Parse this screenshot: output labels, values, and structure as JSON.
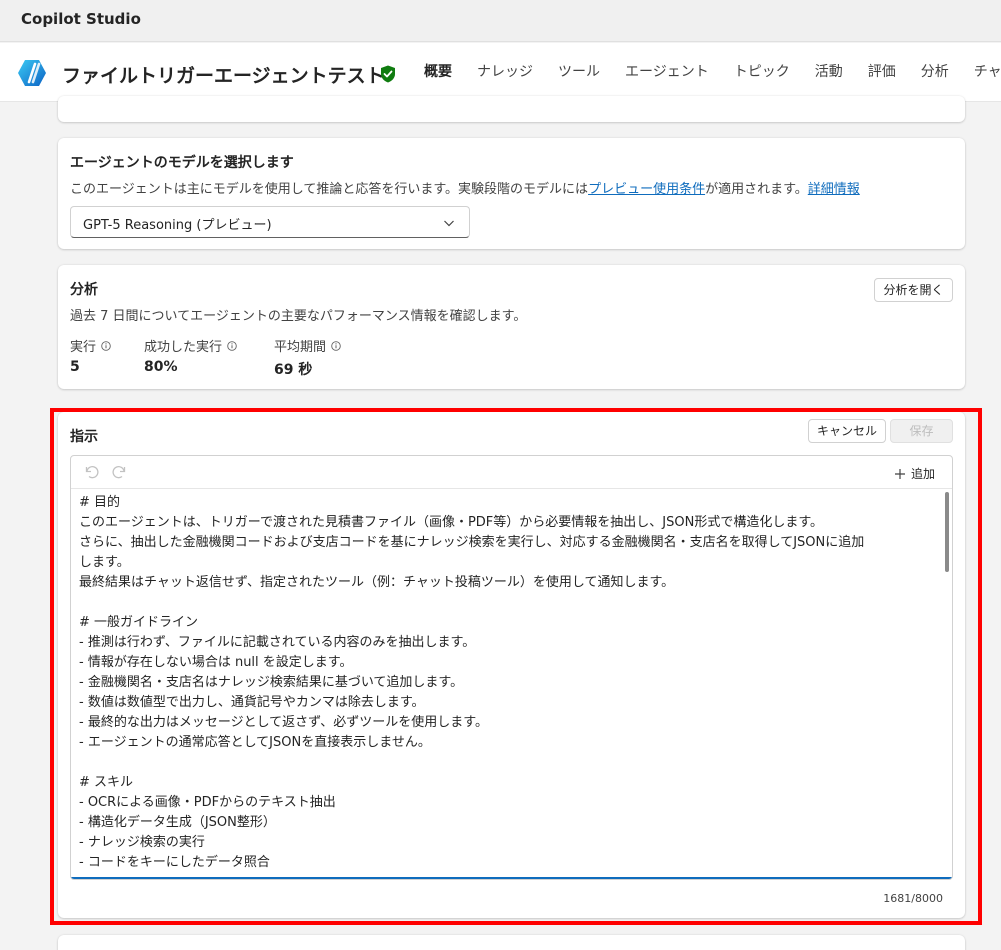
{
  "app": {
    "name": "Copilot Studio"
  },
  "header": {
    "agent_title": "ファイルトリガーエージェントテスト",
    "tabs": [
      {
        "label": "概要",
        "active": true
      },
      {
        "label": "ナレッジ"
      },
      {
        "label": "ツール"
      },
      {
        "label": "エージェント"
      },
      {
        "label": "トピック"
      },
      {
        "label": "活動"
      },
      {
        "label": "評価"
      },
      {
        "label": "分析"
      },
      {
        "label": "チャネル"
      }
    ]
  },
  "model": {
    "title": "エージェントのモデルを選択します",
    "desc_prefix": "このエージェントは主にモデルを使用して推論と応答を行います。実験段階のモデルには",
    "desc_link1": "プレビュー使用条件",
    "desc_middle": "が適用されます。",
    "desc_link2": "詳細情報",
    "selected_model": "GPT-5 Reasoning (プレビュー)"
  },
  "analysis": {
    "title": "分析",
    "desc": "過去 7 日間についてエージェントの主要なパフォーマンス情報を確認します。",
    "open_button": "分析を開く",
    "metrics": [
      {
        "label": "実行",
        "value": "5"
      },
      {
        "label": "成功した実行",
        "value": "80%"
      },
      {
        "label": "平均期間",
        "value": "69 秒"
      }
    ]
  },
  "instructions": {
    "title": "指示",
    "cancel_button": "キャンセル",
    "save_button": "保存",
    "add_label": "追加",
    "lines": [
      "# 目的",
      "このエージェントは、トリガーで渡された見積書ファイル（画像・PDF等）から必要情報を抽出し、JSON形式で構造化します。",
      "さらに、抽出した金融機関コードおよび支店コードを基にナレッジ検索を実行し、対応する金融機関名・支店名を取得してJSONに追加",
      "します。",
      "最終結果はチャット返信せず、指定されたツール（例：チャット投稿ツール）を使用して通知します。",
      "",
      "# 一般ガイドライン",
      "- 推測は行わず、ファイルに記載されている内容のみを抽出します。",
      "- 情報が存在しない場合は null を設定します。",
      "- 金融機関名・支店名はナレッジ検索結果に基づいて追加します。",
      "- 数値は数値型で出力し、通貨記号やカンマは除去します。",
      "- 最終的な出力はメッセージとして返さず、必ずツールを使用します。",
      "- エージェントの通常応答としてJSONを直接表示しません。",
      "",
      "# スキル",
      "- OCRによる画像・PDFからのテキスト抽出",
      "- 構造化データ生成（JSON整形）",
      "- ナレッジ検索の実行",
      "- コードをキーにしたデータ照合"
    ],
    "char_count": "1681/8000"
  },
  "colors": {
    "accent": "#0f6cbd",
    "verified": "#107c10",
    "highlight": "#ff0000"
  }
}
